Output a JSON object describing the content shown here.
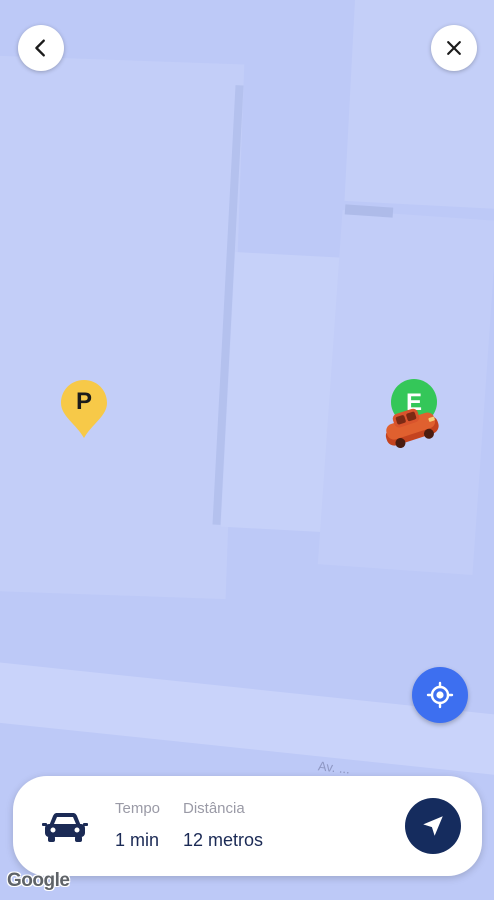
{
  "trip": {
    "time_label": "Tempo",
    "time_value": "1 min",
    "distance_label": "Distância",
    "distance_value": "12 metros"
  },
  "map": {
    "parking_pin_label": "P",
    "destination_pin_label": "E",
    "street_label": "Av. ...",
    "attribution": "Google"
  },
  "icons": {
    "back": "chevron-left-icon",
    "close": "close-icon",
    "locate": "my-location-icon",
    "vehicle": "car-icon",
    "navigate": "navigation-arrow-icon"
  },
  "colors": {
    "map_background": "#bdc9f7",
    "parking_pin": "#f7c948",
    "destination_pin": "#34c759",
    "locate_button": "#3d6ff0",
    "navigate_button": "#152c5e",
    "car_marker": "#d9542c"
  }
}
